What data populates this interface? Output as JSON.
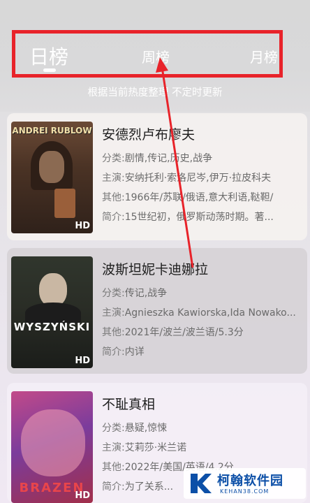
{
  "tabs": {
    "day": "日榜",
    "week": "周榜",
    "month": "月榜"
  },
  "subtitle": "根据当前热度整理 不定时更新",
  "movies": [
    {
      "title": "安德烈卢布廖夫",
      "poster_text": "ANDREI RUBLOW",
      "badge": "HD",
      "genre_label": "分类:",
      "genre": "剧情,传记,历史,战争",
      "cast_label": "主演:",
      "cast": "安纳托利·索洛尼岑,伊万·拉皮科夫",
      "other_label": "其他:",
      "other": "1966年/苏联/俄语,意大利语,鞑靼/",
      "intro_label": "简介:",
      "intro": "15世纪初，俄罗斯动荡时期。著..."
    },
    {
      "title": "波斯坦妮卡迪娜拉",
      "poster_text": "WYSZYŃSKI",
      "badge": "HD",
      "genre_label": "分类:",
      "genre": "传记,战争",
      "cast_label": "主演:",
      "cast": "Agnieszka Kawiorska,Ida Nowako...",
      "other_label": "其他:",
      "other": "2021年/波兰/波兰语/5.3分",
      "intro_label": "简介:",
      "intro": "内详"
    },
    {
      "title": "不耻真相",
      "poster_text": "BRAZEN",
      "badge": "HD",
      "genre_label": "分类:",
      "genre": "悬疑,惊悚",
      "cast_label": "主演:",
      "cast": "艾莉莎·米兰诺",
      "other_label": "其他:",
      "other": "2022年/美国/英语/4.2分",
      "intro_label": "简介:",
      "intro": "为了关系..."
    }
  ],
  "watermark": {
    "name": "柯翰软件园",
    "url": "KEHAN38.COM"
  },
  "colors": {
    "highlight_box": "#e8232a",
    "arrow": "#e8232a",
    "watermark_blue": "#0c4fa7"
  }
}
